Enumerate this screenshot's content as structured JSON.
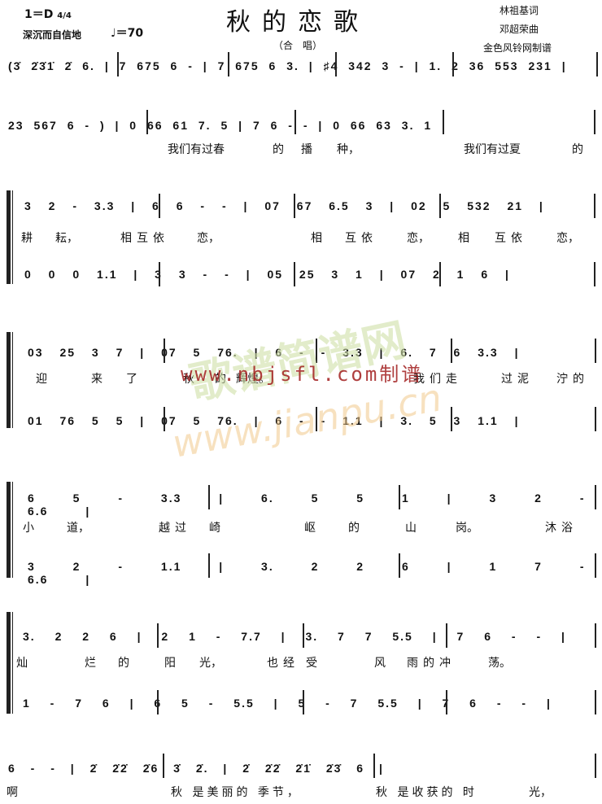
{
  "header": {
    "key_signature": "1＝D",
    "time_signature": "4/4",
    "expression": "深沉而自信地",
    "tempo": "♩＝70",
    "title": "秋的恋歌",
    "subtitle": "（合　唱）",
    "lyricist": "林祖基词",
    "composer": "邓超荣曲",
    "transcriber": "金色风铃网制谱"
  },
  "systems": [
    {
      "type": "single",
      "notes": "(3̇  2̇3̇1̇  2̇ 6.  | 7  675 6  -  | 7  675 6 3.  | ♯4  342 3  -  | 1. 2 36 553 231 |"
    },
    {
      "type": "single",
      "notes": "23  567 6  - ) | 0 66 61  7.  5 | 7  6  -  -  | 0 66 63  3.  1 |",
      "lyrics": [
        "我们有过春",
        "的",
        "播",
        "种，",
        "我们有过夏",
        "的"
      ]
    },
    {
      "type": "duet",
      "upper": "3  2  -  3.3 | 6  6  -  - | 07 67 6.5 3 | 02  5  532 21 |",
      "lyrics": [
        "耕",
        "耘，",
        "相互依",
        "恋，",
        "相",
        "互依",
        "恋，",
        "相",
        "互依",
        "恋，"
      ],
      "lower": "0  0  0  1.1 | 3  3  -  - | 05 25 3  1 | 07  2  1  6 |"
    },
    {
      "type": "duet",
      "upper": "03 25 3  7 | 07  5  76. | 6  -  -  3.3 | 6.  7 6  3.3 |",
      "lyrics": [
        "迎",
        "来",
        "了",
        "秋",
        "的",
        "辉煌。",
        "我们走",
        "过泥",
        "泞的"
      ],
      "lower": "01 76 5  5 | 07  5  76. | 6  -  -  1.1 | 3.  5 3  1.1 |"
    },
    {
      "type": "duet",
      "upper": "6  5  -  3.3 | 6.  5  5  1 | 3  2  -  6.6 |",
      "lyrics": [
        "小",
        "道，",
        "越过",
        "崎",
        "岖",
        "的",
        "山",
        "岗。",
        "沐浴"
      ],
      "lower": "3  2  -  1.1 | 3.  2  2  6 | 1  7  -  6.6 |"
    },
    {
      "type": "duet",
      "upper": "3.  2  2  6 | 2  1  -  7.7 | 3.  7  7  5.5 | 7  6  -  - |",
      "lyrics": [
        "灿",
        "烂",
        "的",
        "阳",
        "光，",
        "也经",
        "受",
        "风",
        "雨的冲",
        "荡。"
      ],
      "lower": "1  -  7  6 | 6  5  -  5.5 | 5  -  7  5.5 | 7  6  -  - |"
    },
    {
      "type": "single",
      "notes": "6  -  - | 2̇ 2̇2̇ 2̇6 3̇ 2̇. | 2̇ 2̇2̇ 2̇1̇ 2̇3̇ 6 |",
      "lyrics": [
        "啊",
        "秋 是美丽的 季节，",
        "秋 是收获的 时",
        "光，"
      ]
    }
  ],
  "watermarks": {
    "site_text": "www.nbjsfl.com制谱",
    "site2_text": "www.jianpu.cn",
    "logo_text": "歌谱简谱网"
  },
  "colors": {
    "ink": "#111111",
    "watermark_red": "#a21e1e",
    "watermark_green": "#cfe0a8",
    "watermark_orange": "#f2c98c"
  }
}
